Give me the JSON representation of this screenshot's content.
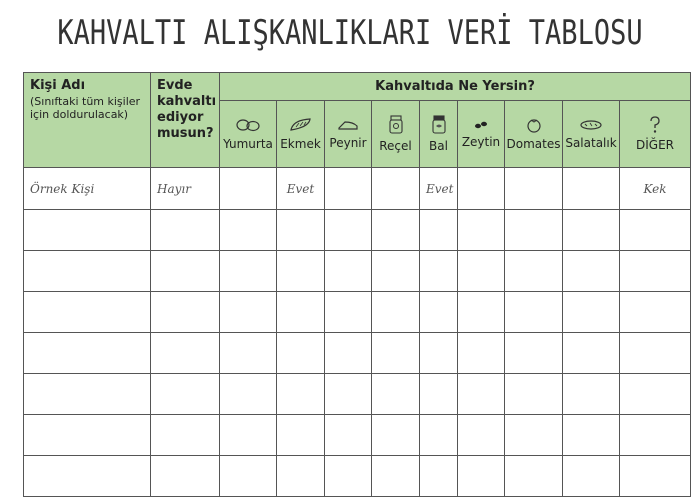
{
  "title": "KAHVALTI ALIŞKANLIKLARI VERİ TABLOSU",
  "header": {
    "person": {
      "label": "Kişi Adı",
      "note": "(Sınıftaki tüm kişiler için doldurulacak)"
    },
    "evde": "Evde kahvaltı ediyor musun?",
    "group": "Kahvaltıda Ne Yersin?",
    "foods": [
      {
        "label": "Yumurta",
        "icon": "egg-icon"
      },
      {
        "label": "Ekmek",
        "icon": "bread-icon"
      },
      {
        "label": "Peynir",
        "icon": "cheese-icon"
      },
      {
        "label": "Reçel",
        "icon": "jam-jar-icon"
      },
      {
        "label": "Bal",
        "icon": "honey-jar-icon"
      },
      {
        "label": "Zeytin",
        "icon": "olive-icon"
      },
      {
        "label": "Domates",
        "icon": "tomato-icon"
      },
      {
        "label": "Salatalık",
        "icon": "cucumber-icon"
      },
      {
        "label": "DİĞER",
        "icon": "question-icon"
      }
    ]
  },
  "rows": [
    [
      "Örnek Kişi",
      "Hayır",
      "",
      "Evet",
      "",
      "",
      "Evet",
      "",
      "",
      "",
      "Kek"
    ],
    [
      "",
      "",
      "",
      "",
      "",
      "",
      "",
      "",
      "",
      "",
      ""
    ],
    [
      "",
      "",
      "",
      "",
      "",
      "",
      "",
      "",
      "",
      "",
      ""
    ],
    [
      "",
      "",
      "",
      "",
      "",
      "",
      "",
      "",
      "",
      "",
      ""
    ],
    [
      "",
      "",
      "",
      "",
      "",
      "",
      "",
      "",
      "",
      "",
      ""
    ],
    [
      "",
      "",
      "",
      "",
      "",
      "",
      "",
      "",
      "",
      "",
      ""
    ],
    [
      "",
      "",
      "",
      "",
      "",
      "",
      "",
      "",
      "",
      "",
      ""
    ],
    [
      "",
      "",
      "",
      "",
      "",
      "",
      "",
      "",
      "",
      "",
      ""
    ]
  ]
}
